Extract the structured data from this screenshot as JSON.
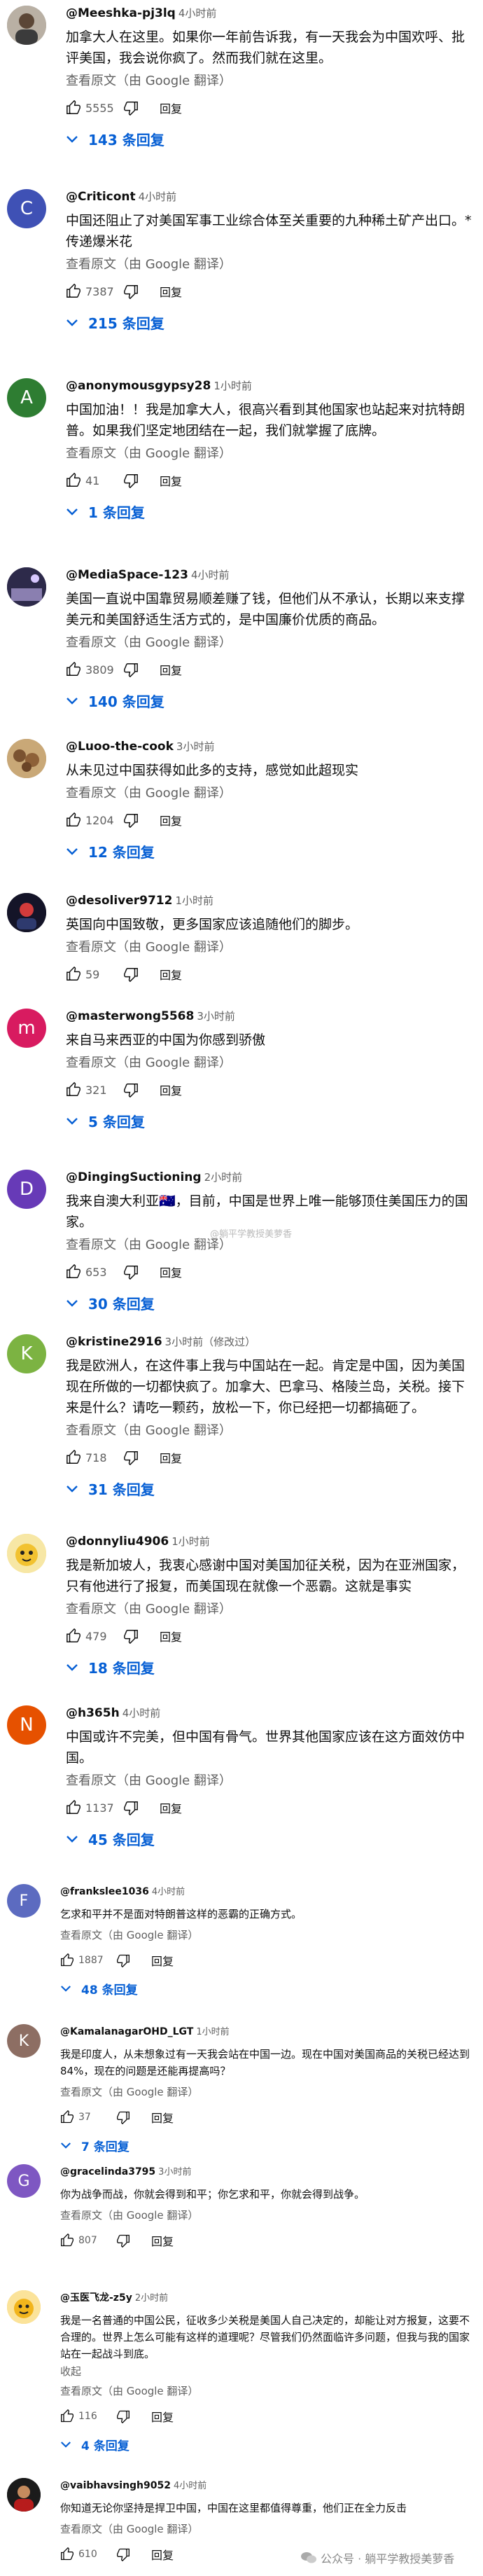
{
  "common": {
    "translate": "查看原文（由 Google 翻译）",
    "reply": "回复",
    "read_more": "收起"
  },
  "colors": {
    "link": "#065fd4",
    "muted": "#606060"
  },
  "comments": [
    {
      "author": "@Meeshka-pj3lq",
      "time": "4小时前",
      "text": "加拿大人在这里。如果你一年前告诉我，有一天我会为中国欢呼、批评美国，我会说你疯了。然而我们就在这里。",
      "likes": "5555",
      "replies": "143 条回复",
      "avatar_letter": "",
      "avatar_color": "#8a8a8a"
    },
    {
      "author": "@Criticont",
      "time": "4小时前",
      "text": "中国还阻止了对美国军事工业综合体至关重要的九种稀土矿产出口。*传递爆米花",
      "likes": "7387",
      "replies": "215 条回复",
      "avatar_letter": "C",
      "avatar_color": "#3f51b5"
    },
    {
      "author": "@anonymousgypsy28",
      "time": "1小时前",
      "text": "中国加油！！我是加拿大人，很高兴看到其他国家也站起来对抗特朗普。如果我们坚定地团结在一起，我们就掌握了底牌。",
      "likes": "41",
      "replies": "1 条回复",
      "avatar_letter": "A",
      "avatar_color": "#2e7d32"
    },
    {
      "author": "@MediaSpace-123",
      "time": "4小时前",
      "text": "美国一直说中国靠贸易顺差赚了钱，但他们从不承认，长期以来支撑美元和美国舒适生活方式的，是中国廉价优质的商品。",
      "likes": "3809",
      "replies": "140 条回复",
      "avatar_letter": "",
      "avatar_color": "#3a2f5a"
    },
    {
      "author": "@Luoo-the-cook",
      "time": "3小时前",
      "text": "从未见过中国获得如此多的支持，感觉如此超现实",
      "likes": "1204",
      "replies": "12 条回复",
      "avatar_letter": "",
      "avatar_color": "#b08a5a"
    },
    {
      "author": "@desoliver9712",
      "time": "1小时前",
      "text": "英国向中国致敬，更多国家应该追随他们的脚步。",
      "likes": "59",
      "replies": "",
      "avatar_letter": "",
      "avatar_color": "#1a1a2e"
    },
    {
      "author": "@masterwong5568",
      "time": "3小时前",
      "text": "来自马来西亚的中国为你感到骄傲",
      "likes": "321",
      "replies": "5 条回复",
      "avatar_letter": "m",
      "avatar_color": "#d81b60"
    },
    {
      "author": "@DingingSuctioning",
      "time": "2小时前",
      "text": "我来自澳大利亚🇦🇺，目前，中国是世界上唯一能够顶住美国压力的国家。",
      "likes": "653",
      "replies": "30 条回复",
      "avatar_letter": "D",
      "avatar_color": "#673ab7"
    },
    {
      "author": "@kristine2916",
      "time": "3小时前（修改过）",
      "text": "我是欧洲人，在这件事上我与中国站在一起。肯定是中国，因为美国现在所做的一切都快疯了。加拿大、巴拿马、格陵兰岛，关税。接下来是什么？请吃一颗药，放松一下，你已经把一切都搞砸了。",
      "likes": "718",
      "replies": "31 条回复",
      "avatar_letter": "K",
      "avatar_color": "#7cb342"
    },
    {
      "author": "@donnyliu4906",
      "time": "1小时前",
      "text": "我是新加坡人，我衷心感谢中国对美国加征关税，因为在亚洲国家，只有他进行了报复，而美国现在就像一个恶霸。这就是事实",
      "likes": "479",
      "replies": "18 条回复",
      "avatar_letter": "",
      "avatar_color": "#f4d35e"
    },
    {
      "author": "@h365h",
      "time": "4小时前",
      "text": "中国或许不完美，但中国有骨气。世界其他国家应该在这方面效仿中国。",
      "likes": "1137",
      "replies": "45 条回复",
      "avatar_letter": "N",
      "avatar_color": "#e65100"
    },
    {
      "author": "@frankslee1036",
      "time": "4小时前",
      "text": "乞求和平并不是面对特朗普这样的恶霸的正确方式。",
      "likes": "1887",
      "replies": "48 条回复",
      "avatar_letter": "F",
      "avatar_color": "#5c6bc0"
    },
    {
      "author": "@KamalanagarOHD_LGT",
      "time": "1小时前",
      "text": "我是印度人，从未想象过有一天我会站在中国一边。现在中国对美国商品的关税已经达到84%，现在的问题是还能再提高吗？",
      "likes": "37",
      "replies": "7 条回复",
      "avatar_letter": "K",
      "avatar_color": "#8d6e63"
    },
    {
      "author": "@gracelinda3795",
      "time": "3小时前",
      "text": "你为战争而战，你就会得到和平；你乞求和平，你就会得到战争。",
      "likes": "807",
      "replies": "",
      "avatar_letter": "G",
      "avatar_color": "#7e57c2"
    },
    {
      "author": "@玉医飞龙-z5y",
      "time": "2小时前",
      "text": "我是一名普通的中国公民，征收多少关税是美国人自己决定的，却能让对方报复，这要不合理的。世界上怎么可能有这样的道理呢？尽管我们仍然面临许多问题，但我与我的国家站在一起战斗到底。",
      "likes": "116",
      "replies": "4 条回复",
      "avatar_letter": "",
      "avatar_color": "#f6c344"
    },
    {
      "author": "@vaibhavsingh9052",
      "time": "4小时前",
      "text": "你知道无论你坚持是捍卫中国，中国在这里都值得尊重，他们正在全力反击",
      "likes": "610",
      "replies": "",
      "avatar_letter": "",
      "avatar_color": "#222"
    }
  ],
  "watermark": {
    "text": "公众号 · 躺平学教授美萝香",
    "mid": "@躺平学教授美萝香"
  }
}
